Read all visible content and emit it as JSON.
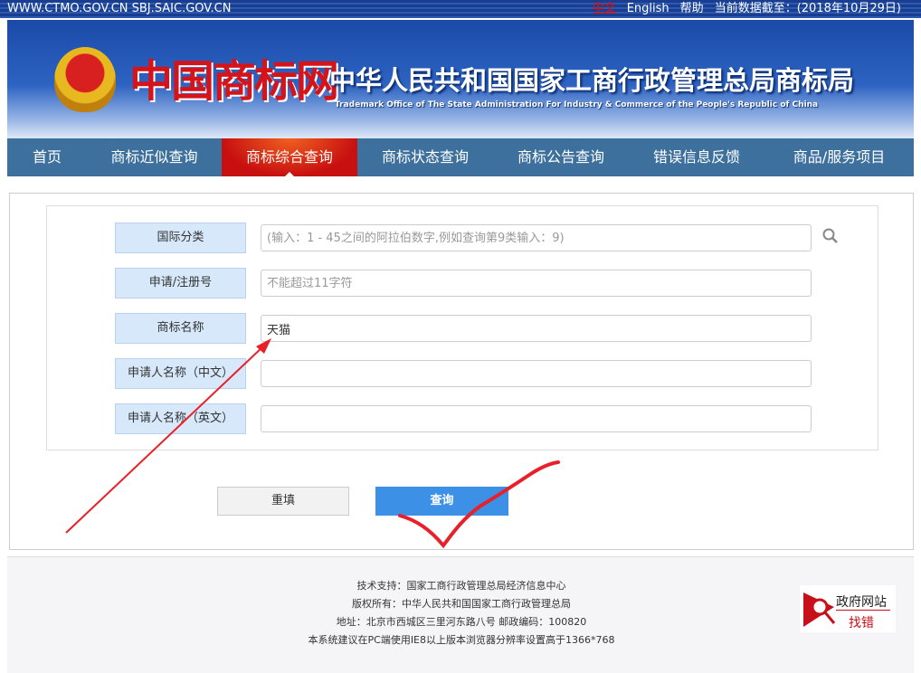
{
  "topbar": {
    "domains": "WWW.CTMO.GOV.CN SBJ.SAIC.GOV.CN",
    "lang_cn": "中文",
    "lang_en": "English",
    "help": "帮助",
    "data_date": "当前数据截至：(2018年10月29日)"
  },
  "header": {
    "logo_text": "中国商标网",
    "title": "中华人民共和国国家工商行政管理总局商标局",
    "subtitle": "Trademark Office of The State Administration For Industry & Commerce of the People's Republic of China"
  },
  "nav": [
    {
      "label": "首页"
    },
    {
      "label": "商标近似查询"
    },
    {
      "label": "商标综合查询",
      "active": true
    },
    {
      "label": "商标状态查询"
    },
    {
      "label": "商标公告查询"
    },
    {
      "label": "错误信息反馈"
    },
    {
      "label": "商品/服务项目"
    }
  ],
  "form": {
    "fields": [
      {
        "label": "国际分类",
        "value": "",
        "placeholder": "(输入：1 - 45之间的阿拉伯数字,例如查询第9类输入：9)"
      },
      {
        "label": "申请/注册号",
        "value": "",
        "placeholder": "不能超过11字符"
      },
      {
        "label": "商标名称",
        "value": "天猫",
        "placeholder": ""
      },
      {
        "label": "申请人名称（中文）",
        "value": "",
        "placeholder": ""
      },
      {
        "label": "申请人名称（英文）",
        "value": "",
        "placeholder": ""
      }
    ],
    "reset_label": "重填",
    "query_label": "查询"
  },
  "footer": {
    "lines": [
      "技术支持：国家工商行政管理总局经济信息中心",
      "版权所有：中华人民共和国国家工商行政管理总局",
      "地址：北京市西城区三里河东路八号  邮政编码：100820",
      "本系统建议在PC端使用IE8以上版本浏览器分辨率设置高于1366*768"
    ],
    "badge_top": "政府网站",
    "badge_bottom": "找错"
  },
  "colors": {
    "nav": "#3d709c",
    "active_tab": "#c81010",
    "query_button": "#3c90e6",
    "annotation": "#e8202a"
  }
}
